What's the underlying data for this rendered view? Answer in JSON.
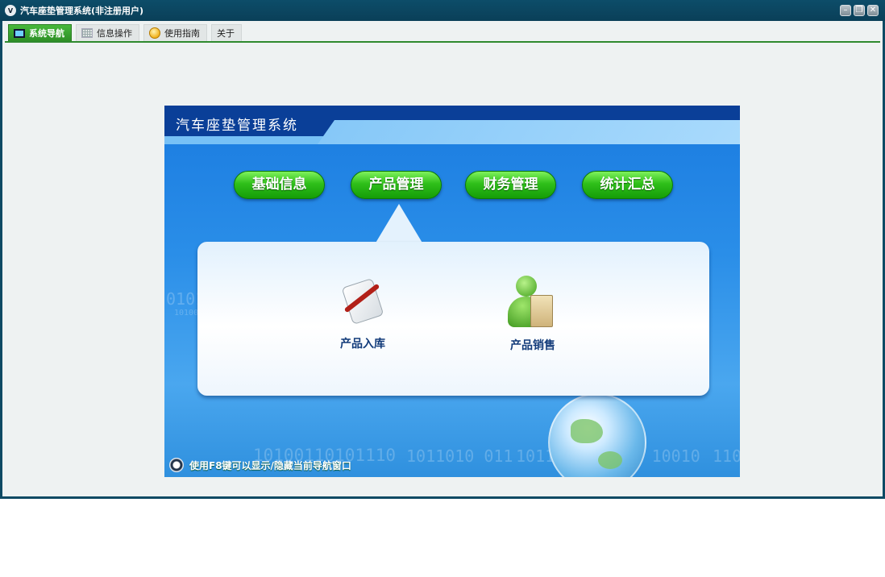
{
  "window": {
    "title": "汽车座垫管理系统(非注册用户)",
    "logo_text": "V",
    "controls": {
      "minimize": "–",
      "restore": "❐",
      "close": "✕"
    }
  },
  "tabs": [
    {
      "label": "系统导航",
      "icon": "monitor-icon",
      "active": true
    },
    {
      "label": "信息操作",
      "icon": "grid-icon",
      "active": false
    },
    {
      "label": "使用指南",
      "icon": "help-icon",
      "active": false
    },
    {
      "label": "关于",
      "icon": null,
      "active": false
    }
  ],
  "panel": {
    "title": "汽车座垫管理系统",
    "modules": [
      "基础信息",
      "产品管理",
      "财务管理",
      "统计汇总"
    ],
    "selected_module": "产品管理",
    "submenu": [
      {
        "label": "产品入库",
        "icon": "scroll-quill-icon"
      },
      {
        "label": "产品销售",
        "icon": "shopper-bag-icon"
      }
    ],
    "hint": "使用F8键可以显示/隐藏当前导航窗口",
    "decor_binary": [
      "0101",
      "10100",
      "10100110101110",
      "1011010  011",
      "1011010110101  10010",
      "110"
    ]
  },
  "colors": {
    "titlebar": "#0d4d69",
    "tab_active": "#2e8f26",
    "panel_blue": "#1a7be0",
    "button_green": "#2fbf1a"
  }
}
